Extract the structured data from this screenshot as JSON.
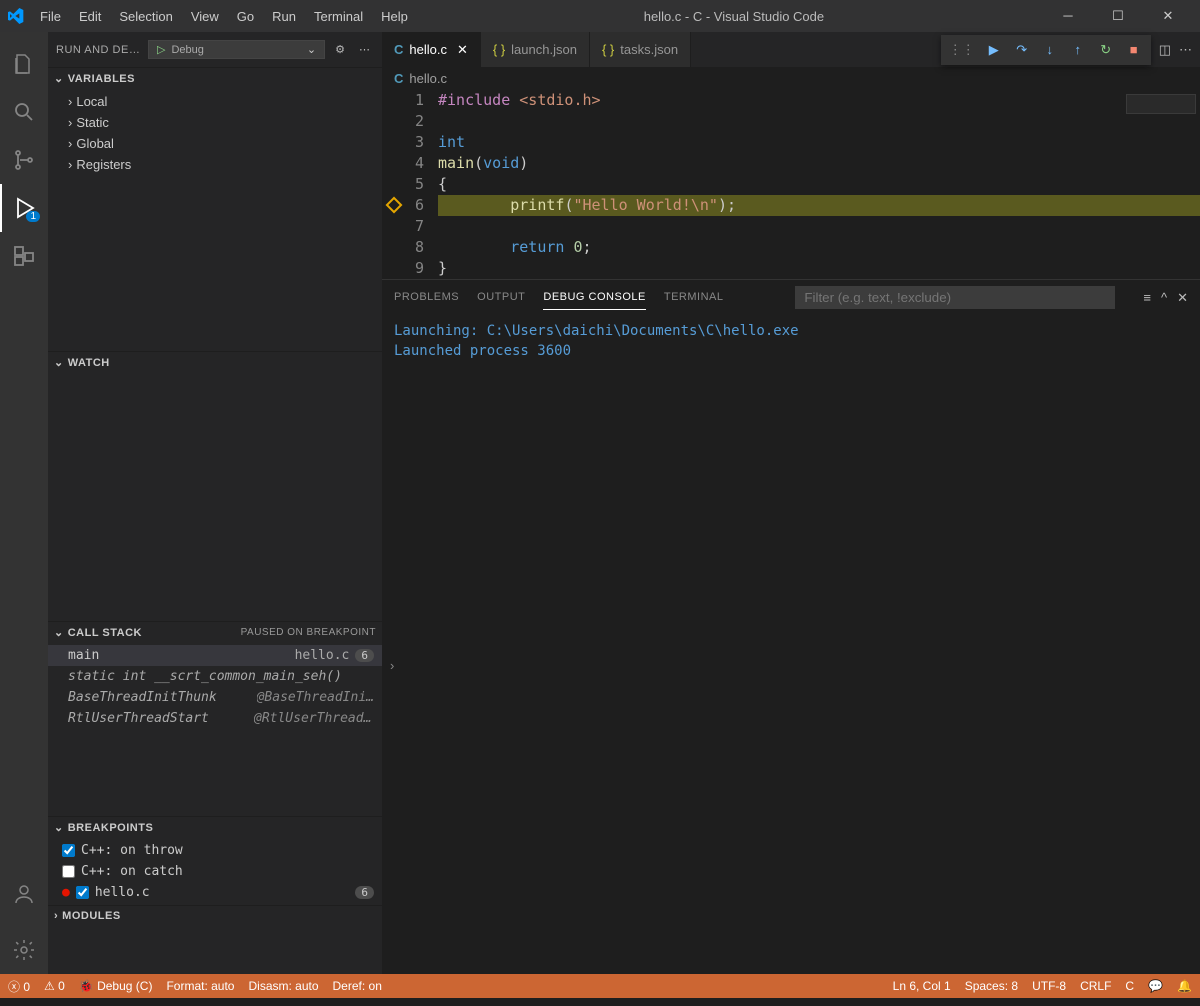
{
  "titlebar": {
    "title": "hello.c - C - Visual Studio Code",
    "menus": [
      "File",
      "Edit",
      "Selection",
      "View",
      "Go",
      "Run",
      "Terminal",
      "Help"
    ]
  },
  "activitybar": {
    "debug_badge": "1"
  },
  "sidebar": {
    "header_title": "RUN AND DEB…",
    "config_name": "Debug",
    "variables": {
      "title": "VARIABLES",
      "items": [
        "Local",
        "Static",
        "Global",
        "Registers"
      ]
    },
    "watch": {
      "title": "WATCH"
    },
    "callstack": {
      "title": "CALL STACK",
      "status": "PAUSED ON BREAKPOINT",
      "frames": [
        {
          "fn": "main",
          "file": "hello.c",
          "line": "6",
          "italic": false
        },
        {
          "fn": "static int __scrt_common_main_seh()",
          "italic": true
        },
        {
          "fn": "BaseThreadInitThunk",
          "mod": "@BaseThreadIni…",
          "italic": true
        },
        {
          "fn": "RtlUserThreadStart",
          "mod": "@RtlUserThreadS…",
          "italic": true
        }
      ]
    },
    "breakpoints": {
      "title": "BREAKPOINTS",
      "items": [
        {
          "label": "C++: on throw",
          "checked": true
        },
        {
          "label": "C++: on catch",
          "checked": false
        },
        {
          "label": "hello.c",
          "checked": true,
          "dot": true,
          "line": "6"
        }
      ]
    },
    "modules": {
      "title": "MODULES"
    }
  },
  "tabs": [
    {
      "label": "hello.c",
      "icon": "c",
      "active": true,
      "close": true
    },
    {
      "label": "launch.json",
      "icon": "json",
      "active": false
    },
    {
      "label": "tasks.json",
      "icon": "json",
      "active": false
    }
  ],
  "breadcrumbs": {
    "icon": "c",
    "file": "hello.c"
  },
  "code": {
    "breakpoint_line": 6,
    "lines": [
      {
        "n": 1,
        "html": "<span class='pp'>#include</span> <span class='str'>&lt;stdio.h&gt;</span>"
      },
      {
        "n": 2,
        "html": ""
      },
      {
        "n": 3,
        "html": "<span class='kw'>int</span>"
      },
      {
        "n": 4,
        "html": "<span class='fncall'>main</span>(<span class='kw'>void</span>)"
      },
      {
        "n": 5,
        "html": "{"
      },
      {
        "n": 6,
        "html": "        <span class='fncall'>printf</span>(<span class='str'>\"Hello World!\\n\"</span>);",
        "hl": true
      },
      {
        "n": 7,
        "html": ""
      },
      {
        "n": 8,
        "html": "        <span class='kw'>return</span> <span class='num'>0</span>;"
      },
      {
        "n": 9,
        "html": "}"
      }
    ]
  },
  "panel": {
    "tabs": [
      "PROBLEMS",
      "OUTPUT",
      "DEBUG CONSOLE",
      "TERMINAL"
    ],
    "active": "DEBUG CONSOLE",
    "filter_placeholder": "Filter (e.g. text, !exclude)",
    "output": [
      "Launching: C:\\Users\\daichi\\Documents\\C\\hello.exe",
      "Launched process 3600"
    ]
  },
  "statusbar": {
    "errors": "0",
    "warnings": "0",
    "debug": "Debug (C)",
    "format": "Format: auto",
    "disasm": "Disasm: auto",
    "deref": "Deref: on",
    "position": "Ln 6, Col 1",
    "spaces": "Spaces: 8",
    "encoding": "UTF-8",
    "eol": "CRLF",
    "lang": "C"
  }
}
